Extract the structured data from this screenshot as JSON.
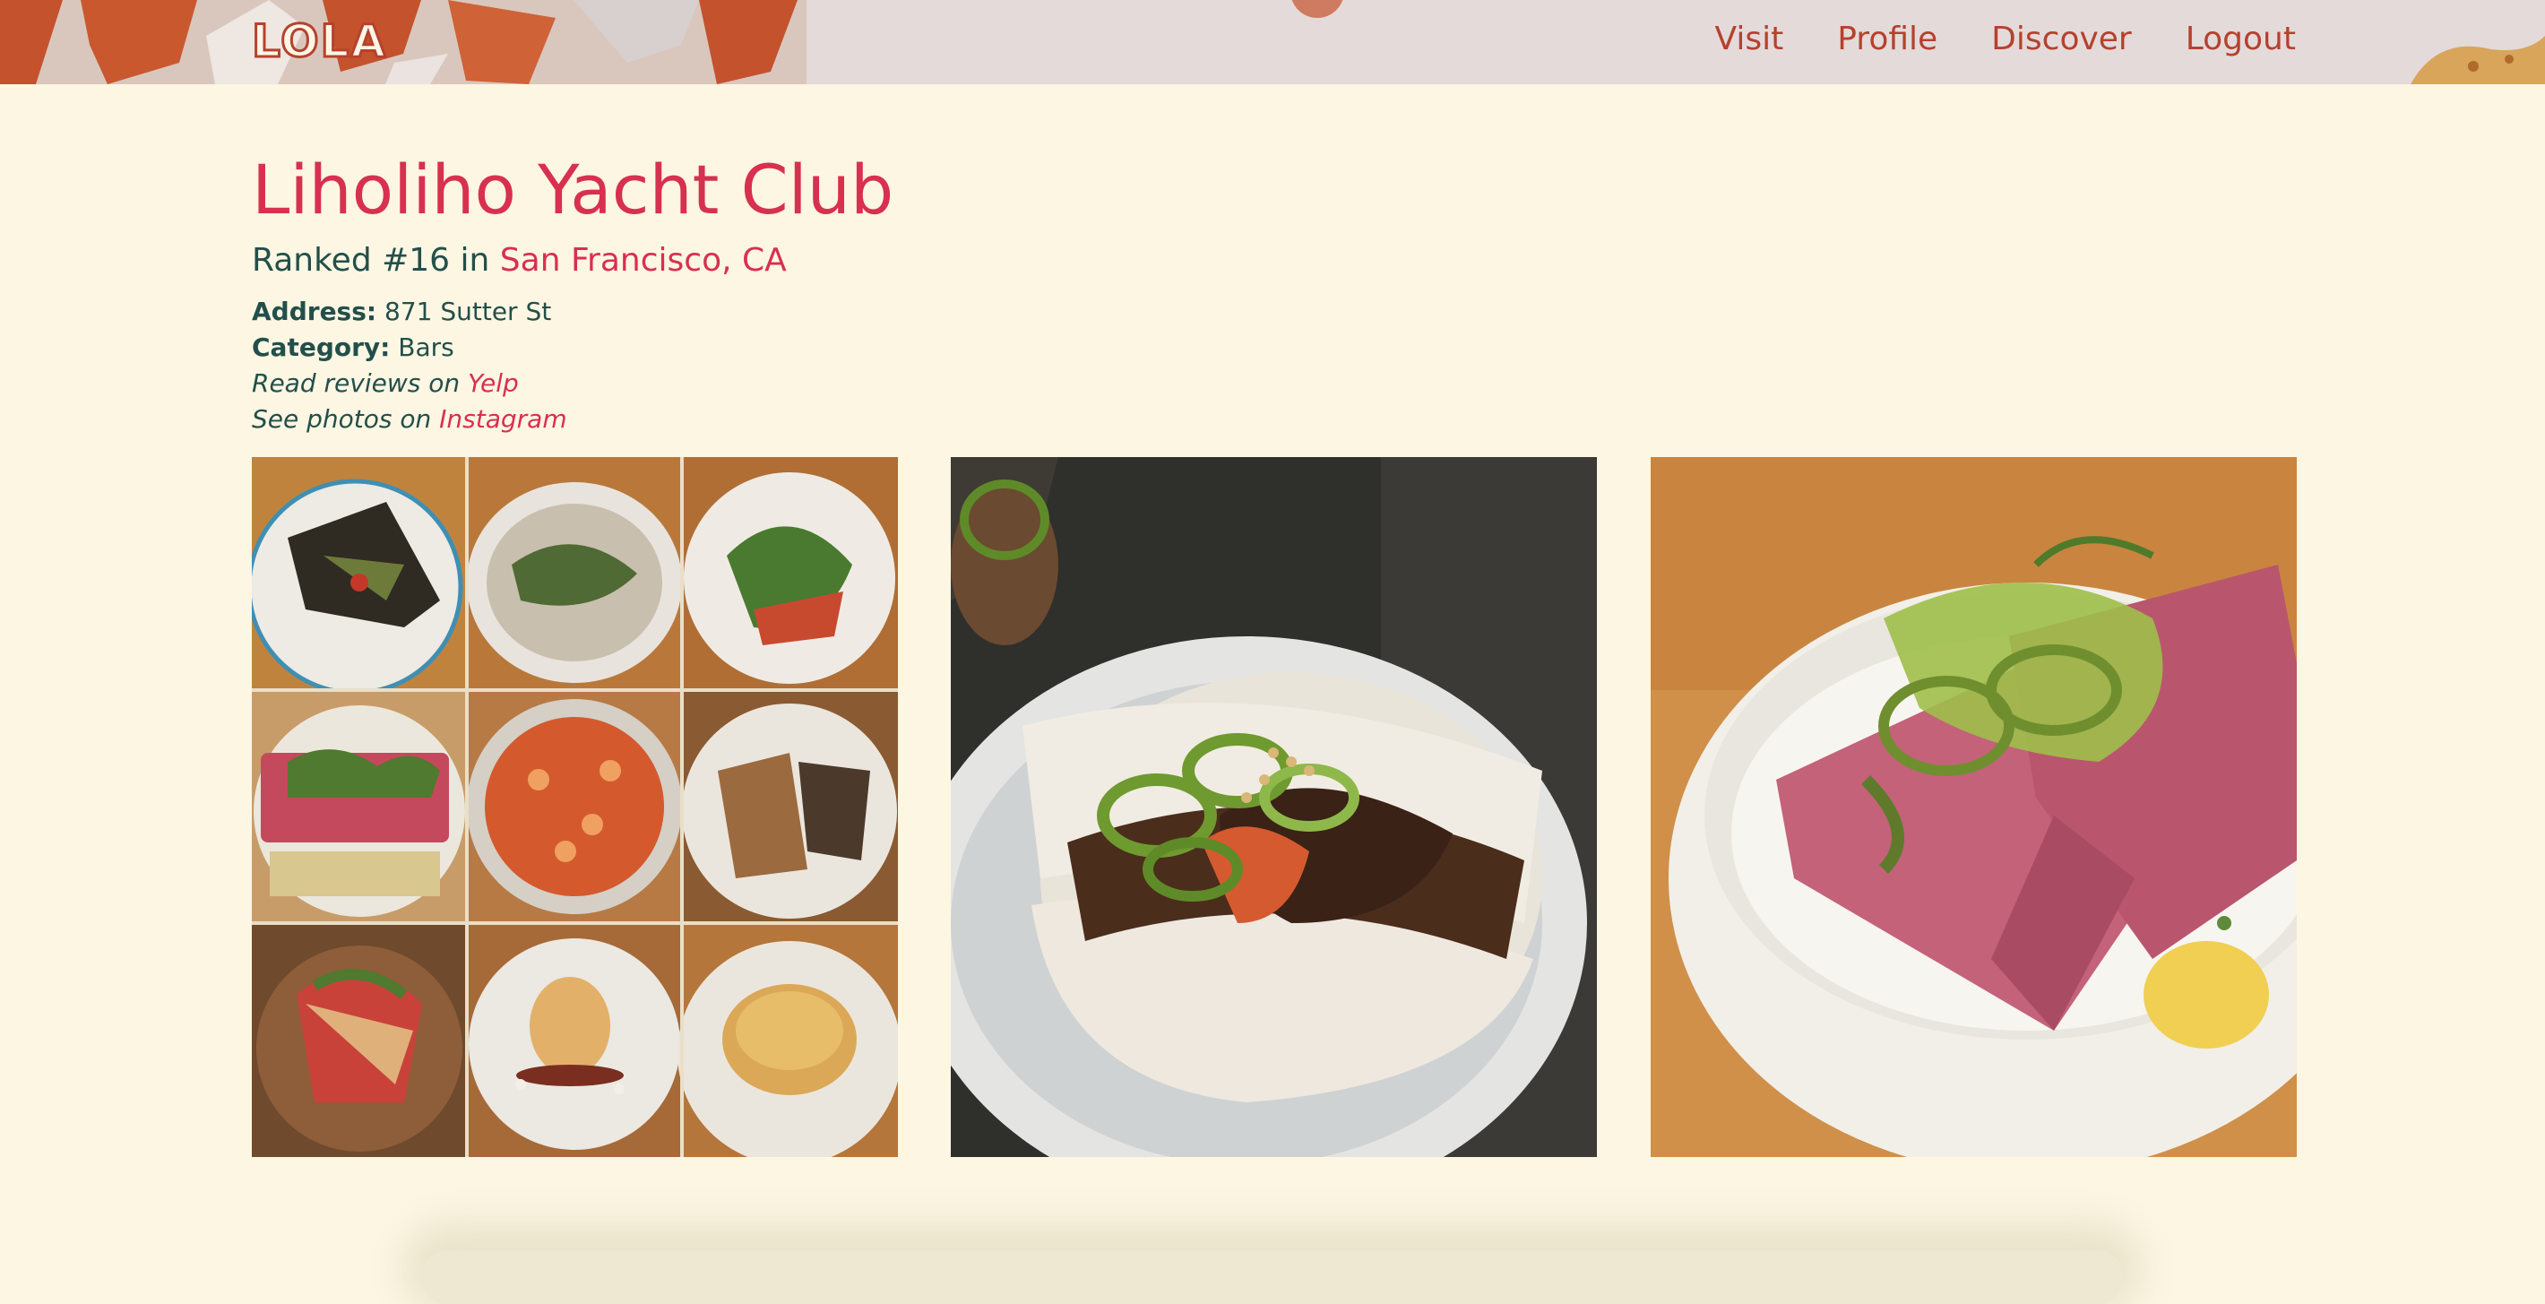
{
  "app": {
    "logo": "LOLA"
  },
  "nav": {
    "items": [
      "Visit",
      "Profile",
      "Discover",
      "Logout"
    ]
  },
  "restaurant": {
    "name": "Liholiho Yacht Club",
    "ranked_prefix": "Ranked #16 in",
    "city": "San Francisco, CA",
    "address_label": "Address:",
    "address": "871 Sutter St",
    "category_label": "Category:",
    "category": "Bars",
    "reviews_prefix": "Read reviews on",
    "reviews_site": "Yelp",
    "photos_prefix": "See photos on",
    "photos_site": "Instagram"
  },
  "colors": {
    "background": "#fcf6e3",
    "accent": "#d8304f",
    "nav": "#b6412d",
    "text": "#234f4a"
  },
  "gallery": {
    "photos": [
      {
        "icon": "food-grid-photo"
      },
      {
        "icon": "bao-bun-photo"
      },
      {
        "icon": "spam-rice-bowl-photo"
      }
    ]
  }
}
